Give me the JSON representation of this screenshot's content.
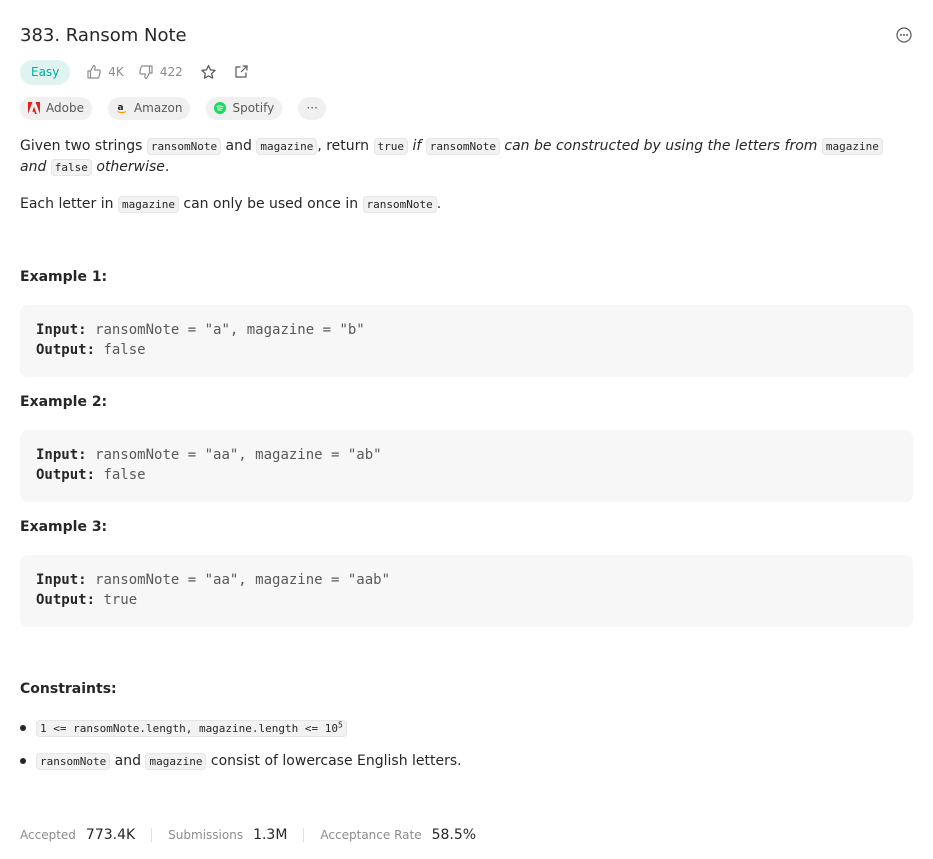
{
  "problem": {
    "title": "383. Ransom Note",
    "difficulty": "Easy",
    "likes": "4K",
    "dislikes": "422"
  },
  "companies": [
    {
      "name": "Adobe",
      "icon": "adobe-logo-icon",
      "color": "#e0231a"
    },
    {
      "name": "Amazon",
      "icon": "amazon-logo-icon",
      "color": "#ff9900"
    },
    {
      "name": "Spotify",
      "icon": "spotify-logo-icon",
      "color": "#1ed760"
    }
  ],
  "more_label": "···",
  "description": {
    "p1_given": "Given two strings ",
    "p1_ransom": "ransomNote",
    "p1_and": " and ",
    "p1_magazine": "magazine",
    "p1_return": ", return ",
    "p1_true": "true",
    "p1_if": " if ",
    "p1_ransom2": "ransomNote",
    "p1_can": " can be constructed by using the letters from ",
    "p1_magazine2": "magazine",
    "p1_and2": " and ",
    "p1_false": "false",
    "p1_otherwise": "otherwise",
    "p1_end": ".",
    "p2_each": "Each letter in ",
    "p2_magazine": "magazine",
    "p2_only": " can only be used once in ",
    "p2_ransom": "ransomNote",
    "p2_end": "."
  },
  "examples": [
    {
      "title": "Example 1:",
      "input_label": "Input:",
      "input": "ransomNote = \"a\", magazine = \"b\"",
      "output_label": "Output:",
      "output": "false"
    },
    {
      "title": "Example 2:",
      "input_label": "Input:",
      "input": "ransomNote = \"aa\", magazine = \"ab\"",
      "output_label": "Output:",
      "output": "false"
    },
    {
      "title": "Example 3:",
      "input_label": "Input:",
      "input": "ransomNote = \"aa\", magazine = \"aab\"",
      "output_label": "Output:",
      "output": "true"
    }
  ],
  "constraints": {
    "title": "Constraints:",
    "c1_code": "1 <= ransomNote.length, magazine.length <= 10",
    "c1_sup": "5",
    "c2_ransom": "ransomNote",
    "c2_and": " and ",
    "c2_magazine": "magazine",
    "c2_rest": " consist of lowercase English letters."
  },
  "footer": {
    "accepted_label": "Accepted",
    "accepted_value": "773.4K",
    "submissions_label": "Submissions",
    "submissions_value": "1.3M",
    "rate_label": "Acceptance Rate",
    "rate_value": "58.5%"
  }
}
